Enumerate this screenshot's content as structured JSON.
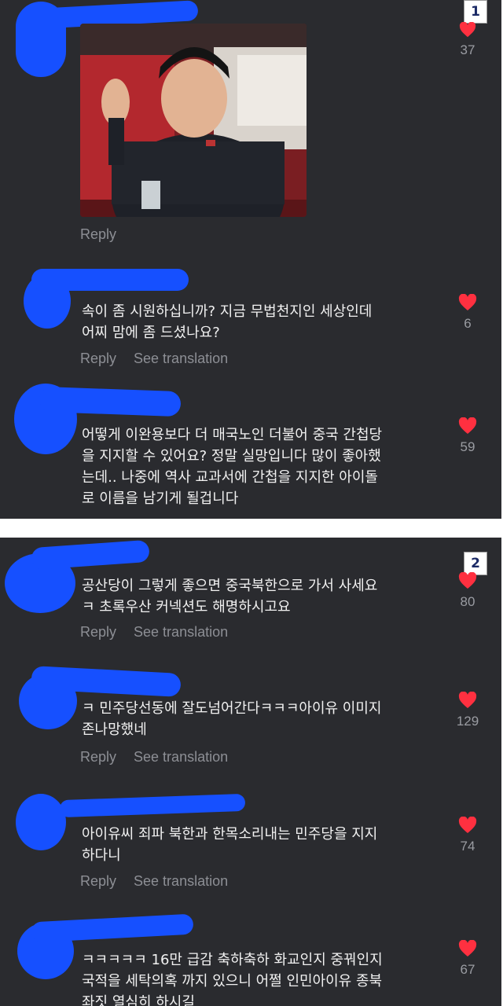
{
  "panel1": {
    "badge": "1",
    "top_likes": "37",
    "reply_under_photo": "Reply",
    "comments": [
      {
        "text": "속이 좀 시원하십니까? 지금 무법천지인 세상인데\n어찌 맘에 좀 드셨나요?",
        "reply": "Reply",
        "translate": "See translation",
        "likes": "6"
      },
      {
        "text": "어떻게 이완용보다 더 매국노인 더불어 중국 간첩당\n을 지지할 수 있어요? 정말 실망입니다 많이 좋아했\n는데.. 나중에 역사 교과서에 간첩을 지지한 아이돌\n로 이름을 남기게 될겁니다",
        "likes": "59"
      }
    ]
  },
  "panel2": {
    "badge": "2",
    "comments": [
      {
        "text": "공산당이 그렇게 좋으면 중국북한으로 가서 사세요\nㅋ 초록우산 커넥션도 해명하시고요",
        "reply": "Reply",
        "translate": "See translation",
        "likes": "80"
      },
      {
        "text": "ㅋ 민주당선동에 잘도넘어간다ㅋㅋㅋ아이유 이미지\n존나망했네",
        "reply": "Reply",
        "translate": "See translation",
        "likes": "129"
      },
      {
        "text": "아이유씨 죄파 북한과 한목소리내는 민주당을 지지\n하다니",
        "reply": "Reply",
        "translate": "See translation",
        "likes": "74"
      },
      {
        "text": "ㅋㅋㅋㅋㅋ 16만 급감 축하축하 화교인지 중꿔인지\n국적을 세탁의혹 까지 있으니 어쩔 인민아이유 종북\n좌짓 열심히 하시길",
        "likes": "67"
      }
    ]
  },
  "colors": {
    "background": "#2a2b2f",
    "heart": "#ff3040",
    "redaction": "#1650ff"
  },
  "icons": {
    "like": "heart-icon"
  }
}
